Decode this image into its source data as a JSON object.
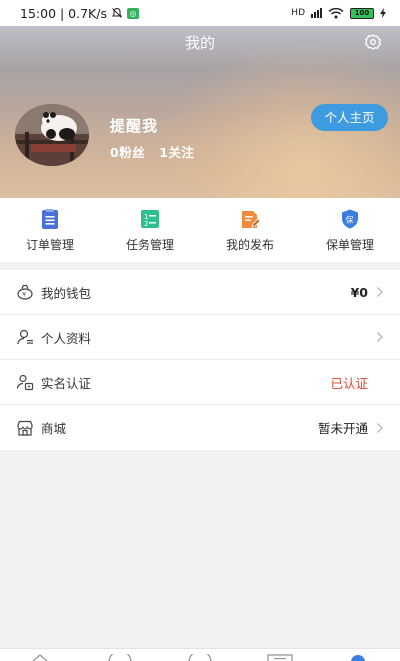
{
  "status_bar": {
    "left_text": "15:00 | 0.7K/s",
    "badge": "◎",
    "network_label": "HD",
    "battery": "100"
  },
  "header": {
    "title": "我的",
    "username": "提醒我",
    "fans": "0粉丝",
    "following": "1关注",
    "home_button": "个人主页"
  },
  "quick_menu": [
    {
      "label": "订单管理",
      "icon": "order-icon",
      "color": "#4a6fd6"
    },
    {
      "label": "任务管理",
      "icon": "task-icon",
      "color": "#2fbf8a"
    },
    {
      "label": "我的发布",
      "icon": "publish-icon",
      "color": "#f08a3c"
    },
    {
      "label": "保单管理",
      "icon": "policy-icon",
      "color": "#3a7fe0"
    }
  ],
  "list": [
    {
      "label": "我的钱包",
      "value": "¥0",
      "icon": "wallet-icon"
    },
    {
      "label": "个人资料",
      "value": "",
      "icon": "profile-icon"
    },
    {
      "label": "实名认证",
      "value": "已认证",
      "icon": "verify-icon"
    },
    {
      "label": "商城",
      "value": "暂未开通",
      "icon": "shop-icon"
    }
  ],
  "colors": {
    "accent": "#3d9be0",
    "verified": "#e0452a"
  }
}
